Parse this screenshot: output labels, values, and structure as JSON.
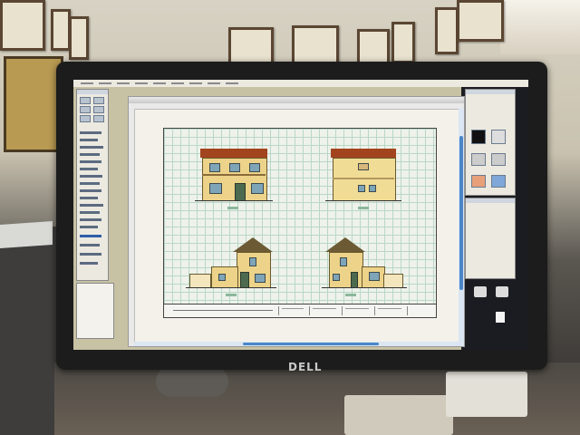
{
  "scene": {
    "monitor_brand": "DELL"
  },
  "colors": {
    "roof": "#a2451f",
    "facade": "#ecd389",
    "grid": "#b9d7c9",
    "window": "#7ea4b8",
    "bezel": "#1c1c1c"
  },
  "icons": [
    "tool-palette-icon",
    "layers-palette-icon",
    "drawing-window-icon"
  ]
}
